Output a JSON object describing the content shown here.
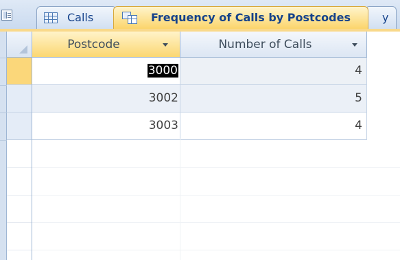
{
  "tabs": [
    {
      "label": "Calls",
      "icon": "table-icon",
      "active": false
    },
    {
      "label": "Frequency of Calls by Postcodes",
      "icon": "query-icon",
      "active": true
    },
    {
      "label": "y",
      "icon": "",
      "active": false
    }
  ],
  "grid": {
    "columns": [
      {
        "label": "Postcode"
      },
      {
        "label": "Number of Calls"
      }
    ],
    "rows": [
      {
        "postcode": "3000",
        "count": "4"
      },
      {
        "postcode": "3002",
        "count": "5"
      },
      {
        "postcode": "3003",
        "count": "4"
      }
    ]
  },
  "colors": {
    "active_tab": "#fbd56b",
    "selection": "#000000",
    "grid_line": "#c6d4e6"
  }
}
